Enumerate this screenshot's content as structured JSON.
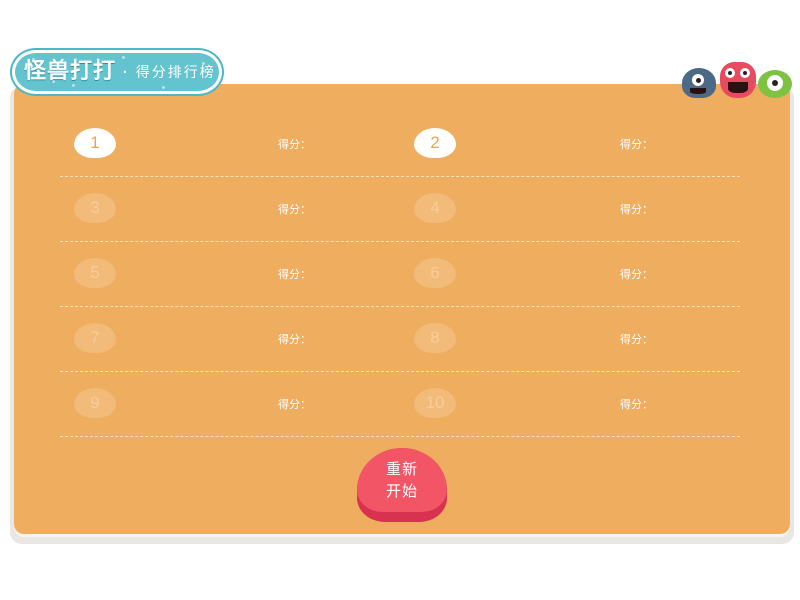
{
  "header": {
    "game_name": "怪兽打打",
    "separator": "·",
    "title": "得分排行榜"
  },
  "leaderboard": {
    "score_label": "得分：",
    "rows": [
      [
        {
          "rank": "1",
          "active": true,
          "score": ""
        },
        {
          "rank": "2",
          "active": true,
          "score": ""
        }
      ],
      [
        {
          "rank": "3",
          "active": false,
          "score": ""
        },
        {
          "rank": "4",
          "active": false,
          "score": ""
        }
      ],
      [
        {
          "rank": "5",
          "active": false,
          "score": ""
        },
        {
          "rank": "6",
          "active": false,
          "score": ""
        }
      ],
      [
        {
          "rank": "7",
          "active": false,
          "score": ""
        },
        {
          "rank": "8",
          "active": false,
          "score": ""
        }
      ],
      [
        {
          "rank": "9",
          "active": false,
          "score": ""
        },
        {
          "rank": "10",
          "active": false,
          "score": ""
        }
      ]
    ]
  },
  "restart_button": {
    "label": "重新开始"
  },
  "colors": {
    "panel": "#efad5f",
    "title_pill": "#63c4cf",
    "button": "#f25566",
    "badge_active": "#ffffff",
    "badge_inactive": "#f2bb7a"
  },
  "icons": [
    "blue-monster-icon",
    "red-monster-icon",
    "green-monster-icon"
  ]
}
